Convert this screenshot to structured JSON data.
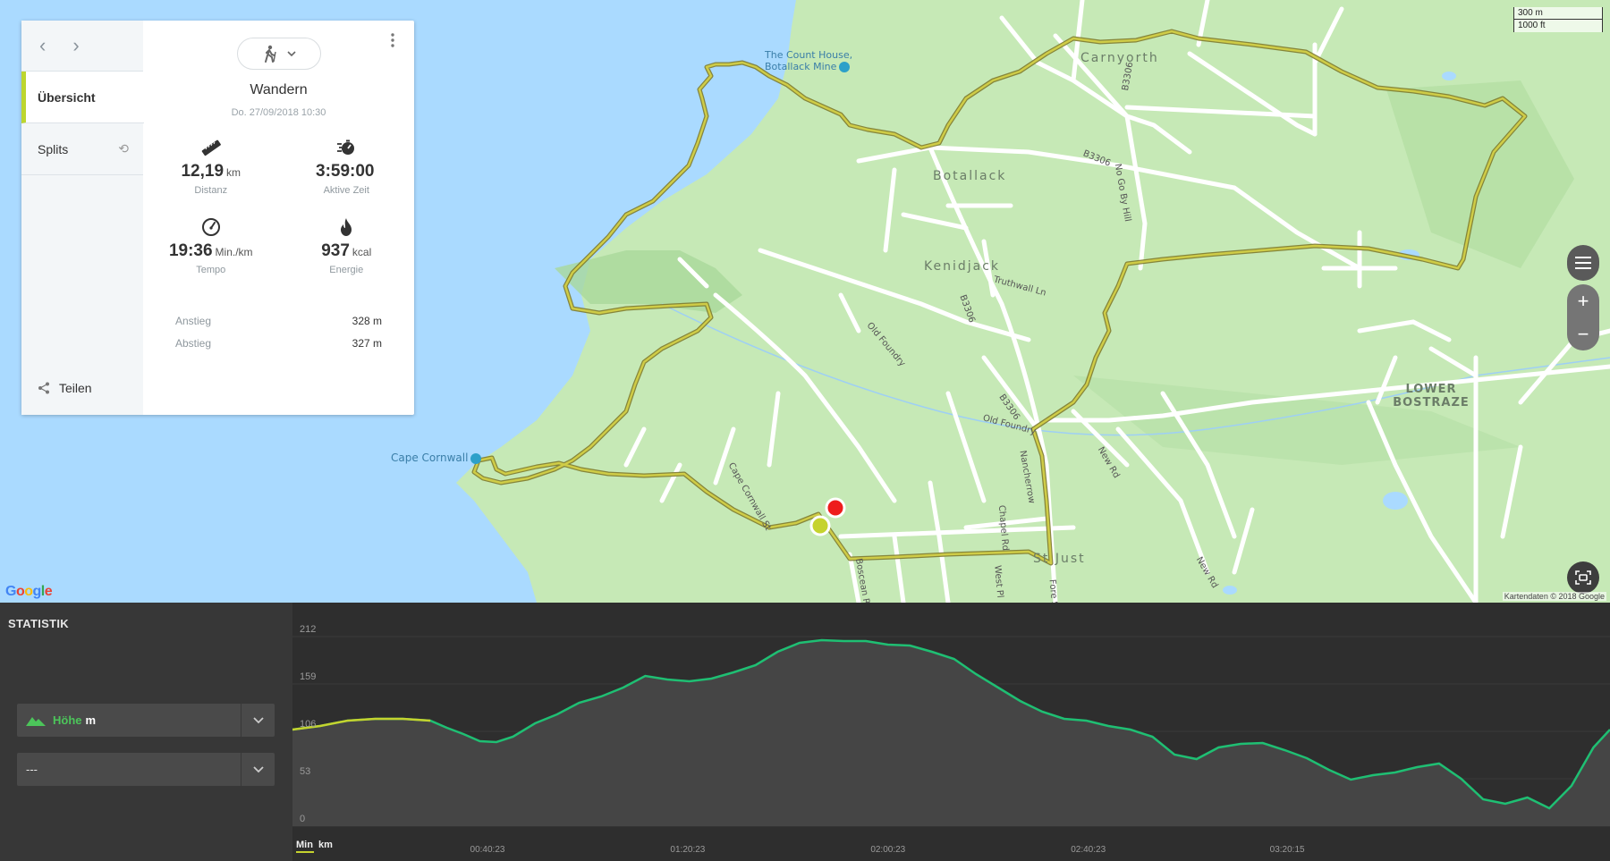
{
  "card": {
    "nav_prev": "‹",
    "nav_next": "›",
    "menu_overview": "Übersicht",
    "menu_splits": "Splits",
    "share_label": "Teilen",
    "sport_icon": "hiking-icon",
    "title": "Wandern",
    "date": "Do. 27/09/2018 10:30",
    "stats": [
      {
        "icon": "ruler-icon",
        "value": "12,19",
        "unit": "km",
        "label": "Distanz"
      },
      {
        "icon": "stopwatch-icon",
        "value": "3:59:00",
        "unit": "",
        "label": "Aktive Zeit"
      },
      {
        "icon": "speedometer-icon",
        "value": "19:36",
        "unit": "Min./km",
        "label": "Tempo"
      },
      {
        "icon": "flame-icon",
        "value": "937",
        "unit": "kcal",
        "label": "Energie"
      }
    ],
    "ascent_label": "Anstieg",
    "ascent_value": "328 m",
    "descent_label": "Abstieg",
    "descent_value": "327 m"
  },
  "map": {
    "places": [
      "Botallack",
      "Kenidjack",
      "Carnyorth",
      "LOWER BOSTRAZE",
      "St Just"
    ],
    "pois": [
      "The Count House, Botallack Mine",
      "Cape Cornwall"
    ],
    "roads": [
      "B3306",
      "B3306",
      "B3306",
      "B3306",
      "Old Foundry",
      "Old Foundry",
      "Truthwall Ln",
      "No Go By Hill",
      "Nancherrow",
      "Cape Cornwall St",
      "Chapel Rd",
      "New Rd",
      "New Rd",
      "Fore St",
      "West Pl",
      "Boscean Rd"
    ],
    "scale_metric": "300 m",
    "scale_imperial": "1000 ft",
    "attribution": "Kartendaten © 2018 Google",
    "google": "Google",
    "route_color": "#b8b53a",
    "start_marker_color": "#c5d32e",
    "end_marker_color": "#ee1c1c"
  },
  "statistics": {
    "title": "STATISTIK",
    "select1_label": "Höhe",
    "select1_unit": "m",
    "select2_label": "---",
    "xaxis_min_label": "Min",
    "xaxis_km_label": "km"
  },
  "chart_data": {
    "type": "area",
    "title": "",
    "ylabel": "",
    "xlabel": "",
    "y_ticks": [
      0,
      53,
      106,
      159,
      212
    ],
    "x_tick_labels": [
      "00:40:23",
      "01:20:23",
      "02:00:23",
      "02:40:23",
      "03:20:15"
    ],
    "ylim": [
      0,
      212
    ],
    "line_color": "#1fbf73",
    "highlight_color": "#c5d32e",
    "series": [
      {
        "x_minutes": [
          0,
          5,
          10,
          15,
          20,
          25,
          28,
          31,
          34,
          37,
          40,
          44,
          48,
          52,
          56,
          60,
          64,
          68,
          72,
          76,
          80,
          84,
          88,
          92,
          96,
          100,
          104,
          108,
          112,
          116,
          120,
          124,
          128,
          132,
          136,
          140,
          144,
          148,
          152,
          156,
          160,
          164,
          168,
          172,
          176,
          180,
          184,
          188,
          192,
          196,
          200,
          204,
          208,
          212,
          216,
          220,
          224,
          228,
          232,
          236,
          239
        ],
        "values": [
          108,
          112,
          118,
          120,
          120,
          118,
          110,
          103,
          95,
          94,
          100,
          115,
          125,
          138,
          145,
          155,
          168,
          164,
          162,
          165,
          172,
          180,
          195,
          205,
          208,
          207,
          207,
          203,
          202,
          195,
          187,
          170,
          155,
          140,
          128,
          120,
          118,
          112,
          108,
          100,
          80,
          75,
          88,
          92,
          93,
          85,
          76,
          63,
          52,
          57,
          60,
          66,
          70,
          53,
          30,
          25,
          32,
          20,
          45,
          88,
          108
        ]
      }
    ]
  }
}
